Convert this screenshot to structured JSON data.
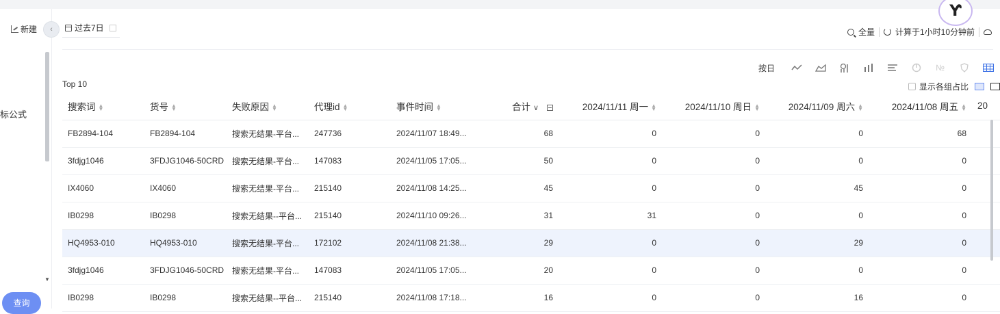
{
  "sidebar": {
    "new_label": "新建",
    "formula_label": "指标公式",
    "query_label": "查询"
  },
  "filter": {
    "date_range": "过去7日"
  },
  "header": {
    "scope": "全量",
    "computed_at": "计算于1小时10分钟前"
  },
  "viewbar": {
    "by_label": "按日",
    "icons": [
      "line-chart-icon",
      "area-chart-icon",
      "funnel-chart-icon",
      "bar-chart-icon",
      "horizontal-bar-icon",
      "pie-chart-icon",
      "number-icon",
      "map-icon",
      "table-icon"
    ]
  },
  "table_title": "Top 10",
  "options": {
    "show_group_ratio": "显示各组占比"
  },
  "table": {
    "headers": [
      "搜索词",
      "货号",
      "失败原因",
      "代理id",
      "事件时间",
      "合计",
      "2024/11/11 周一",
      "2024/11/10 周日",
      "2024/11/09 周六",
      "2024/11/08 周五",
      "20"
    ],
    "rows": [
      [
        "FB2894-104",
        "FB2894-104",
        "搜索无结果-平台...",
        "247736",
        "2024/11/07 18:49...",
        "68",
        "0",
        "0",
        "0",
        "68"
      ],
      [
        "3fdjg1046",
        "3FDJG1046-50CRD",
        "搜索无结果-平台...",
        "147083",
        "2024/11/05 17:05...",
        "50",
        "0",
        "0",
        "0",
        "0"
      ],
      [
        "IX4060",
        "IX4060",
        "搜索无结果-平台...",
        "215140",
        "2024/11/08 14:25...",
        "45",
        "0",
        "0",
        "45",
        "0"
      ],
      [
        "IB0298",
        "IB0298",
        "搜索无结果--平台...",
        "215140",
        "2024/11/10 09:26...",
        "31",
        "31",
        "0",
        "0",
        "0"
      ],
      [
        "HQ4953-010",
        "HQ4953-010",
        "搜索无结果-平台...",
        "172102",
        "2024/11/08 21:38...",
        "29",
        "0",
        "0",
        "29",
        "0"
      ],
      [
        "3fdjg1046",
        "3FDJG1046-50CRD",
        "搜索无结果-平台...",
        "147083",
        "2024/11/05 17:05...",
        "20",
        "0",
        "0",
        "0",
        "0"
      ],
      [
        "IB0298",
        "IB0298",
        "搜索无结果--平台...",
        "215140",
        "2024/11/08 17:18...",
        "16",
        "0",
        "0",
        "16",
        "0"
      ]
    ],
    "highlighted_row": 4
  }
}
